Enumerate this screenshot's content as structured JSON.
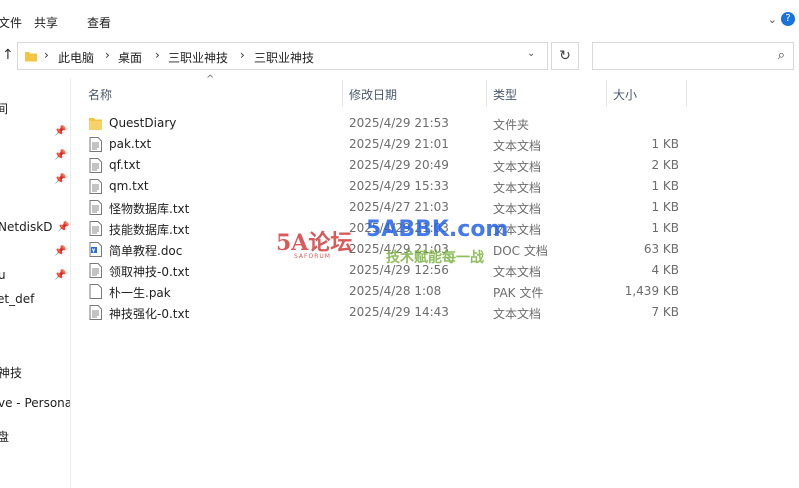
{
  "ribbon": {
    "tabs": [
      "文件",
      "共享",
      "查看"
    ]
  },
  "address": {
    "crumbs": [
      "此电脑",
      "桌面",
      "三职业神技",
      "三职业神技"
    ],
    "search_placeholder": ""
  },
  "sidebar": {
    "items": [
      {
        "label": "间",
        "pinned": false
      },
      {
        "label": "",
        "pinned": true
      },
      {
        "label": "",
        "pinned": true
      },
      {
        "label": "",
        "pinned": true
      },
      {
        "label": "NetdiskD",
        "pinned": true
      },
      {
        "label": "u",
        "pinned": true
      },
      {
        "label": "et_def",
        "pinned": false
      },
      {
        "label": "神技",
        "pinned": false
      },
      {
        "label": "ve - Persona",
        "pinned": false
      },
      {
        "label": "盘",
        "pinned": false
      }
    ]
  },
  "columns": {
    "name": "名称",
    "date": "修改日期",
    "type": "类型",
    "size": "大小"
  },
  "files": [
    {
      "name": "QuestDiary",
      "date": "2025/4/29 21:53",
      "type": "文件夹",
      "size": "",
      "icon": "folder-icon"
    },
    {
      "name": "pak.txt",
      "date": "2025/4/29 21:01",
      "type": "文本文档",
      "size": "1 KB",
      "icon": "text-file-icon"
    },
    {
      "name": "qf.txt",
      "date": "2025/4/29 20:49",
      "type": "文本文档",
      "size": "2 KB",
      "icon": "text-file-icon"
    },
    {
      "name": "qm.txt",
      "date": "2025/4/29 15:33",
      "type": "文本文档",
      "size": "1 KB",
      "icon": "text-file-icon"
    },
    {
      "name": "怪物数据库.txt",
      "date": "2025/4/27 21:03",
      "type": "文本文档",
      "size": "1 KB",
      "icon": "text-file-icon"
    },
    {
      "name": "技能数据库.txt",
      "date": "2025/4/29 21:03",
      "type": "文本文档",
      "size": "1 KB",
      "icon": "text-file-icon"
    },
    {
      "name": "简单教程.doc",
      "date": "2025/4/29 21:03",
      "type": "DOC 文档",
      "size": "63 KB",
      "icon": "doc-file-icon"
    },
    {
      "name": "领取神技-0.txt",
      "date": "2025/4/29 12:56",
      "type": "文本文档",
      "size": "4 KB",
      "icon": "text-file-icon"
    },
    {
      "name": "朴一生.pak",
      "date": "2025/4/28 1:08",
      "type": "PAK 文件",
      "size": "1,439 KB",
      "icon": "blank-file-icon"
    },
    {
      "name": "神技强化-0.txt",
      "date": "2025/4/29 14:43",
      "type": "文本文档",
      "size": "7 KB",
      "icon": "text-file-icon"
    }
  ],
  "watermark": {
    "logo": "5A论坛",
    "site": "5ABBK.com",
    "slogan": "技术赋能每一战",
    "sub": "SAFORUM"
  }
}
